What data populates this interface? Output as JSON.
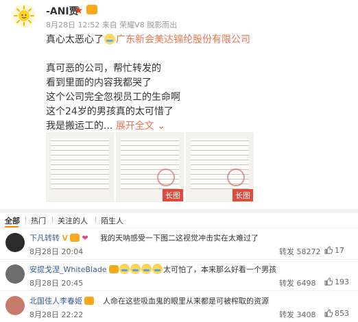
{
  "post": {
    "username": "-ANI贾",
    "meta": "8月28日 12:52 来自 荣耀V8 脱影而出",
    "lines": [
      {
        "prefix": "真心太恶心了",
        "link": "广东新会美达锦纶股份有限公司"
      },
      {
        "text": ""
      },
      {
        "text": "真可恶的公司，帮忙转发的"
      },
      {
        "text": "看到里面的内容我都哭了"
      },
      {
        "text": "这个公司完全忽视员工的生命啊"
      },
      {
        "text": "这个24岁的男孩真的太可惜了"
      }
    ],
    "last_line": "我是搬运工的...",
    "expand_label": "展开全文",
    "images": [
      {
        "tag": ""
      },
      {
        "tag": "长图"
      },
      {
        "tag": "长图"
      },
      {
        "tag": "长图"
      }
    ],
    "image_tags": [
      "长图",
      "长图",
      "长图"
    ]
  },
  "tabs": [
    "全部",
    "热门",
    "关注的人",
    "陌生人"
  ],
  "comments": [
    {
      "name": "下凡转转",
      "text": "我的天呐感受一下图二这视觉冲击实在太难过了",
      "time": "8月28日 20:04",
      "repost": "转发 58272",
      "likes": "17",
      "avatar_color": "#2b2b2b"
    },
    {
      "name": "安提戈涅_WhiteBlade",
      "text": "太可怕了，本来那么好看一个男孩",
      "time": "8月28日 20:45",
      "repost": "转发 6498",
      "likes": "193",
      "avatar_color": "#6d6d6d"
    },
    {
      "name": "北国佳人李春姬",
      "text": "人命在这些吸血鬼的眼里从来都是可被榨取的资源",
      "time": "8月28日 22:22",
      "repost": "转发 3408",
      "likes": "853",
      "avatar_color": "#c97b6b"
    }
  ]
}
